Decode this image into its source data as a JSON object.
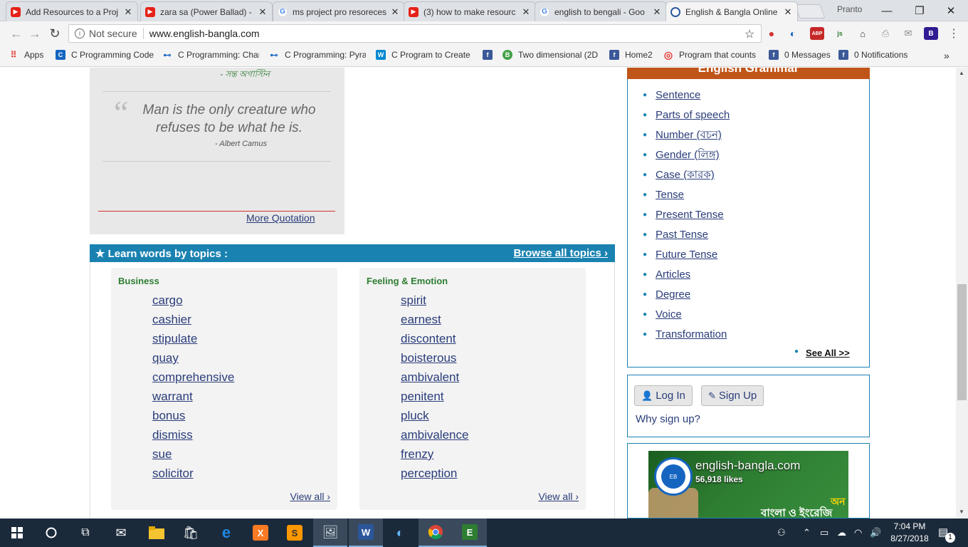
{
  "browser": {
    "tabs": [
      {
        "title": "Add Resources to a Proj",
        "favicon": "youtube-icon"
      },
      {
        "title": "zara sa (Power Ballad) -",
        "favicon": "youtube-icon"
      },
      {
        "title": "ms project pro resoreces",
        "favicon": "google-icon"
      },
      {
        "title": "(3) how to make resourc",
        "favicon": "youtube-icon"
      },
      {
        "title": "english to bengali - Goo",
        "favicon": "google-icon"
      },
      {
        "title": "English & Bangla Online",
        "favicon": "english-bangla-icon",
        "active": true
      }
    ],
    "close_glyph": "✕",
    "profile_name": "Pranto",
    "address": {
      "security": "Not secure",
      "url": "www.english-bangla.com"
    },
    "bookmarks": [
      {
        "label": "Apps",
        "icon": "apps-grid-icon"
      },
      {
        "label": "C Programming Code",
        "icon": "c-icon"
      },
      {
        "label": "C Programming: Char",
        "icon": "c-site-icon"
      },
      {
        "label": "C Programming: Pyra",
        "icon": "c-site-icon"
      },
      {
        "label": "C Program to Create",
        "icon": "w3-icon"
      },
      {
        "label": "",
        "icon": "facebook-icon"
      },
      {
        "label": "Two dimensional (2D",
        "icon": "b-icon"
      },
      {
        "label": "Home2",
        "icon": "facebook-icon"
      },
      {
        "label": "Program that counts",
        "icon": "target-icon"
      },
      {
        "label": "0 Messages",
        "icon": "facebook-icon"
      },
      {
        "label": "0 Notifications",
        "icon": "facebook-icon"
      }
    ],
    "more_glyph": "»"
  },
  "quotes": {
    "bengali_author": "- সন্ত অগাস্টিন",
    "text": "Man is the only creature who refuses to be what he is.",
    "author": "- Albert Camus",
    "more_link": "More Quotation"
  },
  "learn_words": {
    "title": "★ Learn words by topics :",
    "browse_link": "Browse all topics ›",
    "topics": [
      {
        "name": "Business",
        "words": [
          "cargo",
          "cashier",
          "stipulate",
          "quay",
          "comprehensive",
          "warrant",
          "bonus",
          "dismiss",
          "sue",
          "solicitor"
        ],
        "view_all": "View all ›"
      },
      {
        "name": "Feeling & Emotion",
        "words": [
          "spirit",
          "earnest",
          "discontent",
          "boisterous",
          "ambivalent",
          "penitent",
          "pluck",
          "ambivalence",
          "frenzy",
          "perception"
        ],
        "view_all": "View all ›"
      }
    ]
  },
  "grammar": {
    "heading": "English Grammar",
    "items": [
      "Sentence",
      "Parts of speech",
      "Number (বচন)",
      "Gender (লিঙ্গ)",
      "Case (কারক)",
      "Tense",
      "Present Tense",
      "Past Tense",
      "Future Tense",
      "Articles",
      "Degree",
      "Voice",
      "Transformation"
    ],
    "see_all": "See All >>"
  },
  "auth": {
    "login": "Log In",
    "signup": "Sign Up",
    "why": "Why sign up?"
  },
  "facebook_widget": {
    "page_name": "english-bangla.com",
    "likes": "56,918 likes",
    "banner_text": "বাংলা ও ইংরেজি অভি",
    "banner_yellow": "অন"
  },
  "taskbar": {
    "time": "7:04 PM",
    "date": "8/27/2018",
    "notification_count": "1"
  },
  "colors": {
    "accent_blue": "#1a82b1",
    "grammar_orange": "#c0551a",
    "topic_green": "#2e7d32",
    "link_navy": "#2a3d7a"
  }
}
